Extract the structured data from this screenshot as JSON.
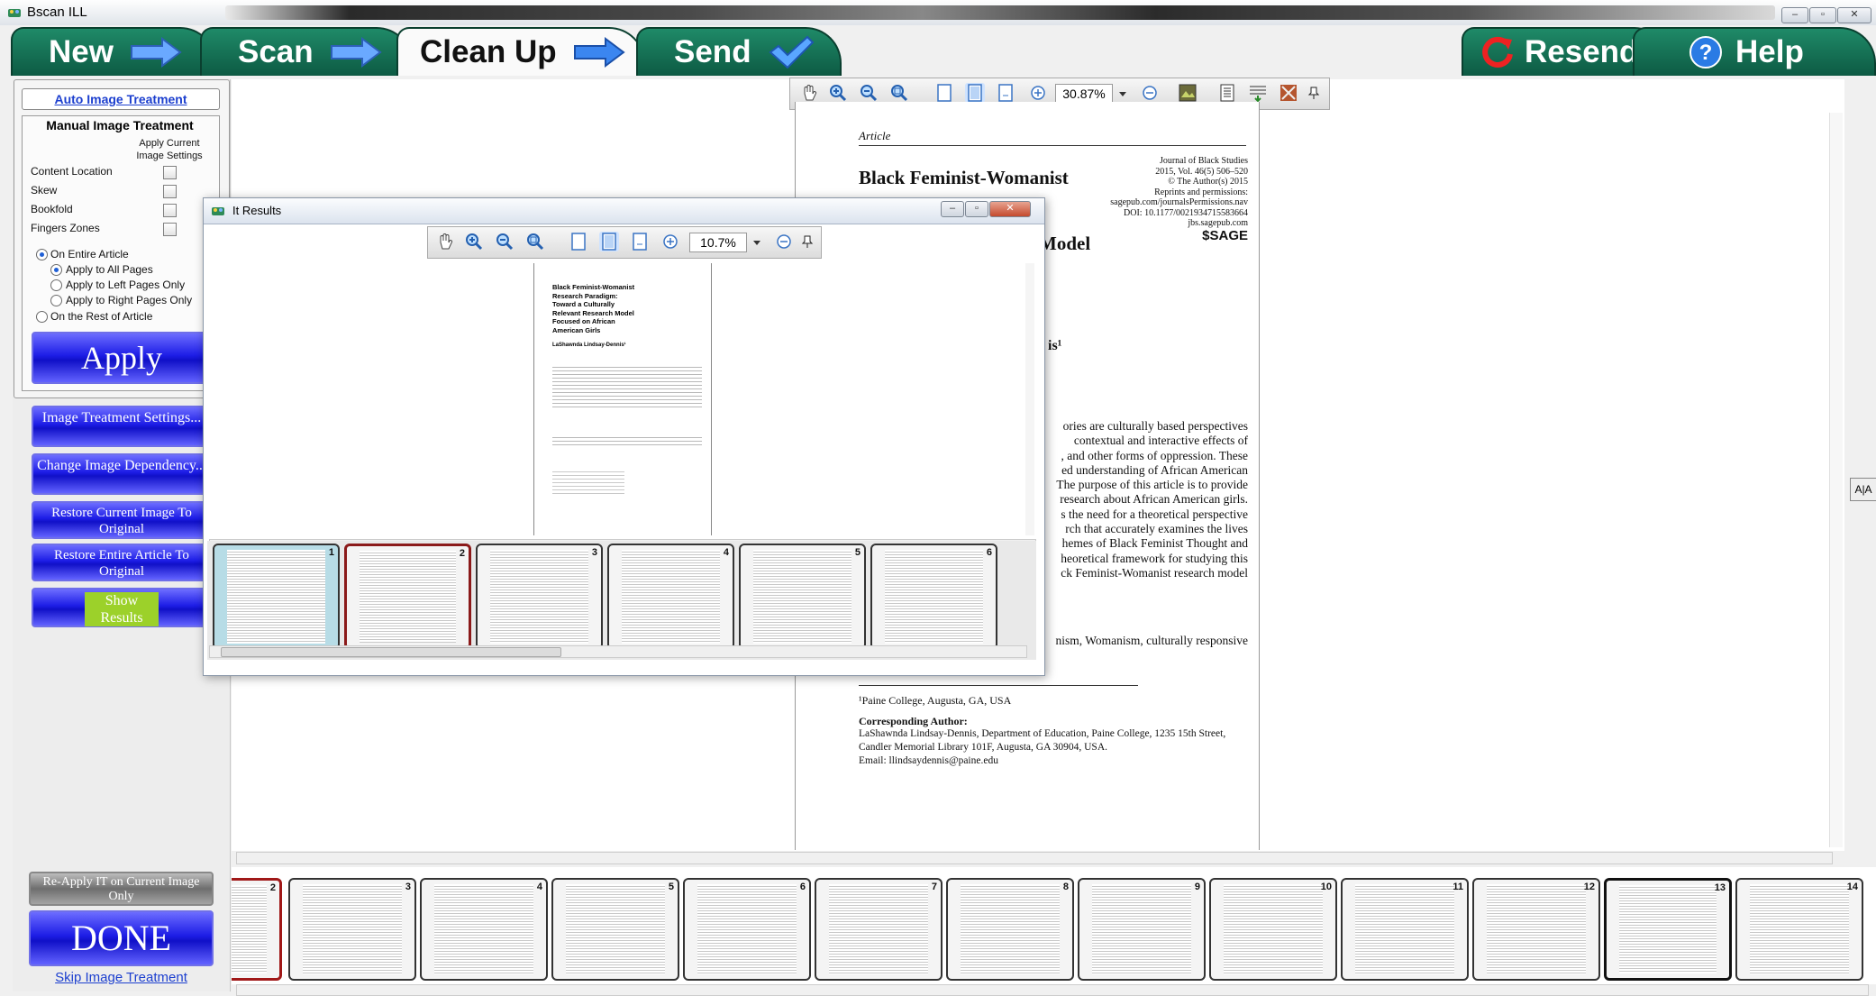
{
  "window": {
    "title": "Bscan ILL",
    "controls": [
      "–",
      "▫",
      "✕"
    ]
  },
  "nav": {
    "tabs": [
      {
        "label": "New",
        "icon": "arrow-right-icon"
      },
      {
        "label": "Scan",
        "icon": "arrow-right-icon"
      },
      {
        "label": "Clean Up",
        "icon": "arrow-right-icon",
        "active": true
      },
      {
        "label": "Send",
        "icon": "checkmark-icon"
      }
    ],
    "resend_label": "Resend",
    "help_label": "Help"
  },
  "left_panel": {
    "auto_treatment": "Auto Image Treatment",
    "manual_title": "Manual Image Treatment",
    "apply_current": "Apply Current Image Settings",
    "options": [
      {
        "label": "Content Location",
        "checked": false
      },
      {
        "label": "Skew",
        "checked": false
      },
      {
        "label": "Bookfold",
        "checked": false
      },
      {
        "label": "Fingers Zones",
        "checked": false
      }
    ],
    "scope": {
      "entire": "On Entire Article",
      "all_pages": "Apply to All Pages",
      "left_pages": "Apply to Left Pages Only",
      "right_pages": "Apply to Right Pages Only",
      "rest": "On the Rest of Article"
    },
    "apply": "Apply",
    "buttons": {
      "settings": "Image Treatment Settings...",
      "dependency": "Change Image Dependency...",
      "restore_current": "Restore Current Image To Original",
      "restore_entire": "Restore Entire Article To Original",
      "show_results": "Show Results"
    },
    "reapply": "Re-Apply IT on Current Image Only",
    "done": "DONE",
    "skip": "Skip Image Treatment"
  },
  "main_toolbar": {
    "zoom": "30.87%"
  },
  "document": {
    "article_label": "Article",
    "journal_info": [
      "Journal of Black Studies",
      "2015, Vol. 46(5) 506–520",
      "© The Author(s) 2015",
      "Reprints and permissions:",
      "sagepub.com/journalsPermissions.nav",
      "DOI: 10.1177/0021934715583664",
      "jbs.sagepub.com"
    ],
    "publisher": "SAGE",
    "title_line1": "Black Feminist-Womanist",
    "title_partial": "Model",
    "author_partial": "is¹",
    "abstract_lines": [
      "ories are culturally based perspectives",
      "contextual and interactive effects of",
      ", and other forms of oppression. These",
      "ed understanding of African American",
      "The purpose of this article is to provide",
      "research about African American girls.",
      "s the need for a theoretical perspective",
      "rch that accurately examines the lives",
      "hemes of Black Feminist Thought and",
      "heoretical framework for studying this",
      "ck Feminist-Womanist research model"
    ],
    "keywords_partial": "nism, Womanism, culturally responsive",
    "affiliation": "¹Paine College, Augusta, GA, USA",
    "corresponding_label": "Corresponding Author:",
    "corresponding_lines": [
      "LaShawnda Lindsay-Dennis, Department of Education, Paine College, 1235 15th Street,",
      "Candler Memorial Library 101F, Augusta, GA 30904, USA.",
      "Email: llindsaydennis@paine.edu"
    ]
  },
  "popup": {
    "title": "It Results",
    "zoom": "10.7%",
    "mini_title": [
      "Black Feminist-Womanist",
      "Research Paradigm:",
      "Toward a Culturally",
      "Relevant Research Model",
      "Focused on African",
      "American Girls"
    ],
    "mini_author": "LaShawnda Lindsay-Dennis¹",
    "thumbs": [
      "1",
      "2",
      "3",
      "4",
      "5",
      "6"
    ]
  },
  "strip": {
    "thumbs": [
      "2",
      "3",
      "4",
      "5",
      "6",
      "7",
      "8",
      "9",
      "10",
      "11",
      "12",
      "13",
      "14"
    ]
  },
  "side_tool": "A|A"
}
